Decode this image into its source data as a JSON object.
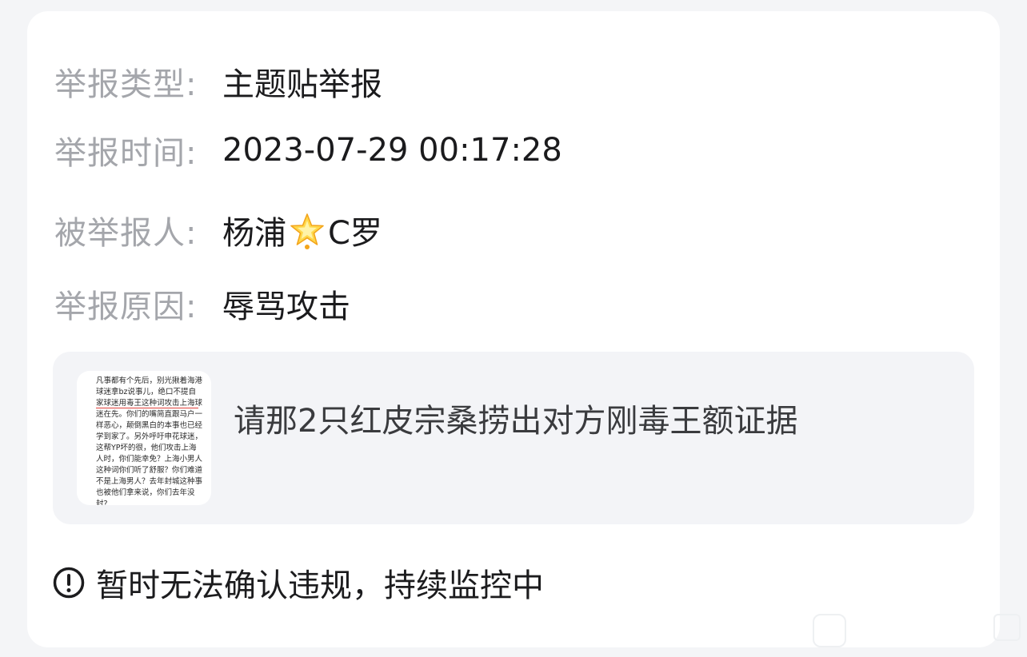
{
  "report": {
    "type_label": "举报类型:",
    "type_value": "主题贴举报",
    "time_label": "举报时间:",
    "time_value": "2023-07-29 00:17:28",
    "reported_label": "被举报人:",
    "reported_name_part1": "杨浦",
    "reported_name_part2": "C罗",
    "reported_emoji": "star-icon",
    "reason_label": "举报原因:",
    "reason_value": "辱骂攻击"
  },
  "evidence": {
    "thumbnail_text": "凡事都有个先后，别光揪着海港球迷拿bz说事儿，绝口不提自家球迷用毒王这种词攻击上海球迷在先。你们的嘴简直跟马户一样恶心，颠倒黑白的本事也已经学到家了。另外呼吁申花球迷，这帮YP坏的很，他们攻击上海人时，你们能幸免？上海小男人这种词你们听了舒服？你们难道不是上海男人？去年封城这种事也被他们拿来说，你们去年没封?",
    "caption": "请那2只红皮宗桑捞出对方刚毒王额证据"
  },
  "status": {
    "icon": "exclamation-circle-icon",
    "text": "暂时无法确认违规，持续监控中"
  },
  "colors": {
    "label": "#a4a6ab",
    "value": "#1b1b1d",
    "card_background": "#ffffff",
    "page_background": "#f4f5f7",
    "evidence_background": "#f3f4f7"
  }
}
